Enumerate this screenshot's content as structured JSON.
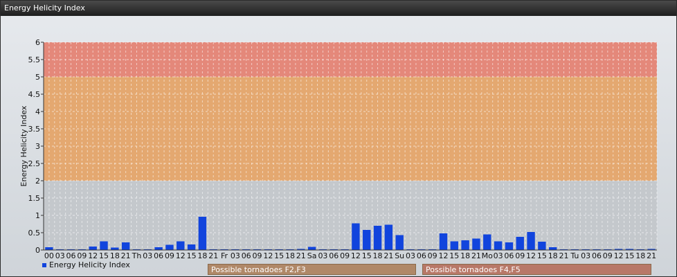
{
  "window": {
    "title": "Energy Helicity Index"
  },
  "legend": {
    "label": "Energy Helicity Index",
    "color": "#1144dd"
  },
  "zones": [
    {
      "label": "Possible tornadoes F2,F3",
      "color": "#b08868"
    },
    {
      "label": "Possible tornadoes F4,F5",
      "color": "#b87868"
    }
  ],
  "chart_data": {
    "type": "bar",
    "ylabel": "Energy Helicity Index",
    "ylim": [
      0,
      6
    ],
    "yticks": [
      "0",
      "0.5",
      "1",
      "1.5",
      "2",
      "2.5",
      "3",
      "3.5",
      "4",
      "4.5",
      "5",
      "5.5",
      "6"
    ],
    "bands": [
      {
        "from": 2,
        "to": 5,
        "color": "#e4a870"
      },
      {
        "from": 5,
        "to": 6,
        "color": "#e4887a"
      }
    ],
    "categories": [
      "00",
      "03",
      "06",
      "09",
      "12",
      "15",
      "18",
      "21",
      "Th",
      "03",
      "06",
      "09",
      "12",
      "15",
      "18",
      "21",
      "Fr",
      "03",
      "06",
      "09",
      "12",
      "15",
      "18",
      "21",
      "Sa",
      "03",
      "06",
      "09",
      "12",
      "15",
      "18",
      "21",
      "Su",
      "03",
      "06",
      "09",
      "12",
      "15",
      "18",
      "21",
      "Mo",
      "03",
      "06",
      "09",
      "12",
      "15",
      "18",
      "21",
      "Tu",
      "03",
      "06",
      "09",
      "12",
      "15",
      "18",
      "21"
    ],
    "series": [
      {
        "color": "#1144dd",
        "values": [
          0.08,
          0.02,
          0.02,
          0.02,
          0.1,
          0.25,
          0.07,
          0.22,
          0.02,
          0.02,
          0.08,
          0.15,
          0.25,
          0.16,
          0.96,
          0.02,
          0.02,
          0.02,
          0.02,
          0.02,
          0.02,
          0.02,
          0.02,
          0.03,
          0.09,
          0.02,
          0.02,
          0.02,
          0.77,
          0.58,
          0.7,
          0.73,
          0.43,
          0.02,
          0.02,
          0.02,
          0.48,
          0.25,
          0.28,
          0.33,
          0.45,
          0.25,
          0.22,
          0.38,
          0.52,
          0.24,
          0.08,
          0.02,
          0.02,
          0.02,
          0.02,
          0.02,
          0.03,
          0.03,
          0.02,
          0.03
        ]
      }
    ]
  }
}
